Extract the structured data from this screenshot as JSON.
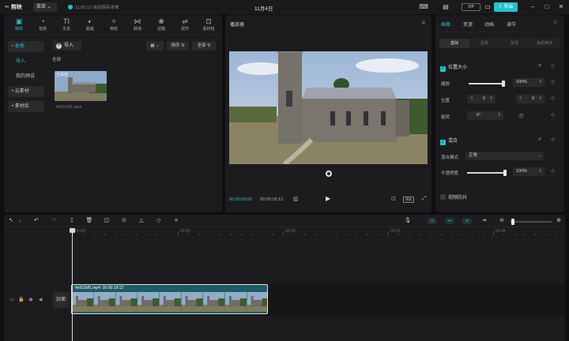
{
  "titlebar": {
    "app_name": "剪映",
    "menu_label": "菜单",
    "save_status": "11:00:12 自动保存本地",
    "doc_title": "11月4日",
    "vip_label": "VIP",
    "export_label": "导出"
  },
  "media_panel": {
    "tabs": [
      {
        "label": "媒体",
        "icon": "media-icon",
        "glyph": "▣"
      },
      {
        "label": "音频",
        "icon": "audio-icon",
        "glyph": "◔"
      },
      {
        "label": "文本",
        "icon": "text-icon",
        "glyph": "TI"
      },
      {
        "label": "贴纸",
        "icon": "sticker-icon",
        "glyph": "◐"
      },
      {
        "label": "特效",
        "icon": "effects-icon",
        "glyph": "✧"
      },
      {
        "label": "转场",
        "icon": "transition-icon",
        "glyph": "⋈"
      },
      {
        "label": "滤镜",
        "icon": "filter-icon",
        "glyph": "❀"
      },
      {
        "label": "调节",
        "icon": "adjust-icon",
        "glyph": "⇌"
      },
      {
        "label": "素材包",
        "icon": "package-icon",
        "glyph": "⊡"
      }
    ],
    "nav": {
      "local": "• 本地",
      "import": "导入",
      "my_presets": "我的预设",
      "cloud": "• 云素材",
      "library": "• 素材库"
    },
    "import_label": "导入",
    "sort_label": "排序",
    "filter_label": "全部",
    "section_all": "全部",
    "thumb_added": "已添加",
    "thumb_filename": "4e910df1.mp4"
  },
  "player": {
    "title": "播放器",
    "current_time": "00:00:00:00",
    "total_time": "00:00:18:12",
    "ratio_label": "原始"
  },
  "properties": {
    "tabs": [
      "画面",
      "变速",
      "动画",
      "调节"
    ],
    "subtabs": [
      "基础",
      "抠像",
      "蒙版",
      "美颜美体"
    ],
    "position_size": "位置大小",
    "scale_label": "缩放",
    "scale_value": "100%",
    "scale_level": 1.0,
    "position_label": "位置",
    "x_label": "X",
    "x_value": "0",
    "y_label": "Y",
    "y_value": "0",
    "rotate_label": "旋转",
    "rotate_value": "0°",
    "mix_label": "混合",
    "blend_mode_label": "混合模式",
    "blend_mode_value": "正常",
    "opacity_label": "不透明度",
    "opacity_value": "100%",
    "opacity_level": 1.0,
    "stabilize_label": "视频防抖"
  },
  "timeline": {
    "ruler_labels": [
      "00:00",
      "00:10",
      "00:20",
      "00:30",
      "00:40"
    ],
    "cover_label": "封面",
    "clip_name": "4e910df1.mp4",
    "clip_duration": "00:00:18:12"
  },
  "colors": {
    "accent": "#23c2c9",
    "panel": "#1c1c1e",
    "background": "#0f0f10",
    "clip": "#1d5c62"
  }
}
